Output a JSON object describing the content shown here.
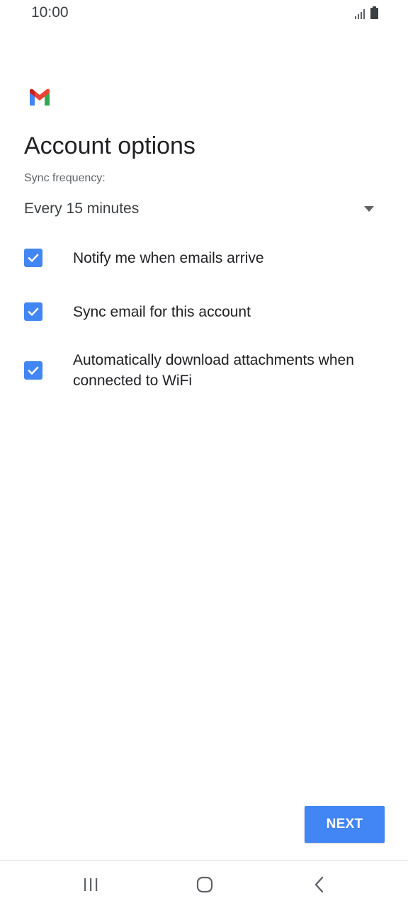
{
  "status_bar": {
    "time": "10:00",
    "icons": [
      "signal-icon",
      "battery-icon"
    ]
  },
  "header": {
    "logo": "gmail-logo",
    "title": "Account options"
  },
  "sync": {
    "label": "Sync frequency:",
    "selected": "Every 15 minutes"
  },
  "options": [
    {
      "label": "Notify me when emails arrive",
      "checked": true
    },
    {
      "label": "Sync email for this account",
      "checked": true
    },
    {
      "label": "Automatically download attachments when connected to WiFi",
      "checked": true
    }
  ],
  "footer": {
    "next_label": "NEXT"
  },
  "nav": {
    "icons": [
      "recent-apps-icon",
      "home-icon",
      "back-icon"
    ]
  },
  "colors": {
    "accent": "#4285f4",
    "text": "#202124",
    "secondary_text": "#5f6368"
  }
}
